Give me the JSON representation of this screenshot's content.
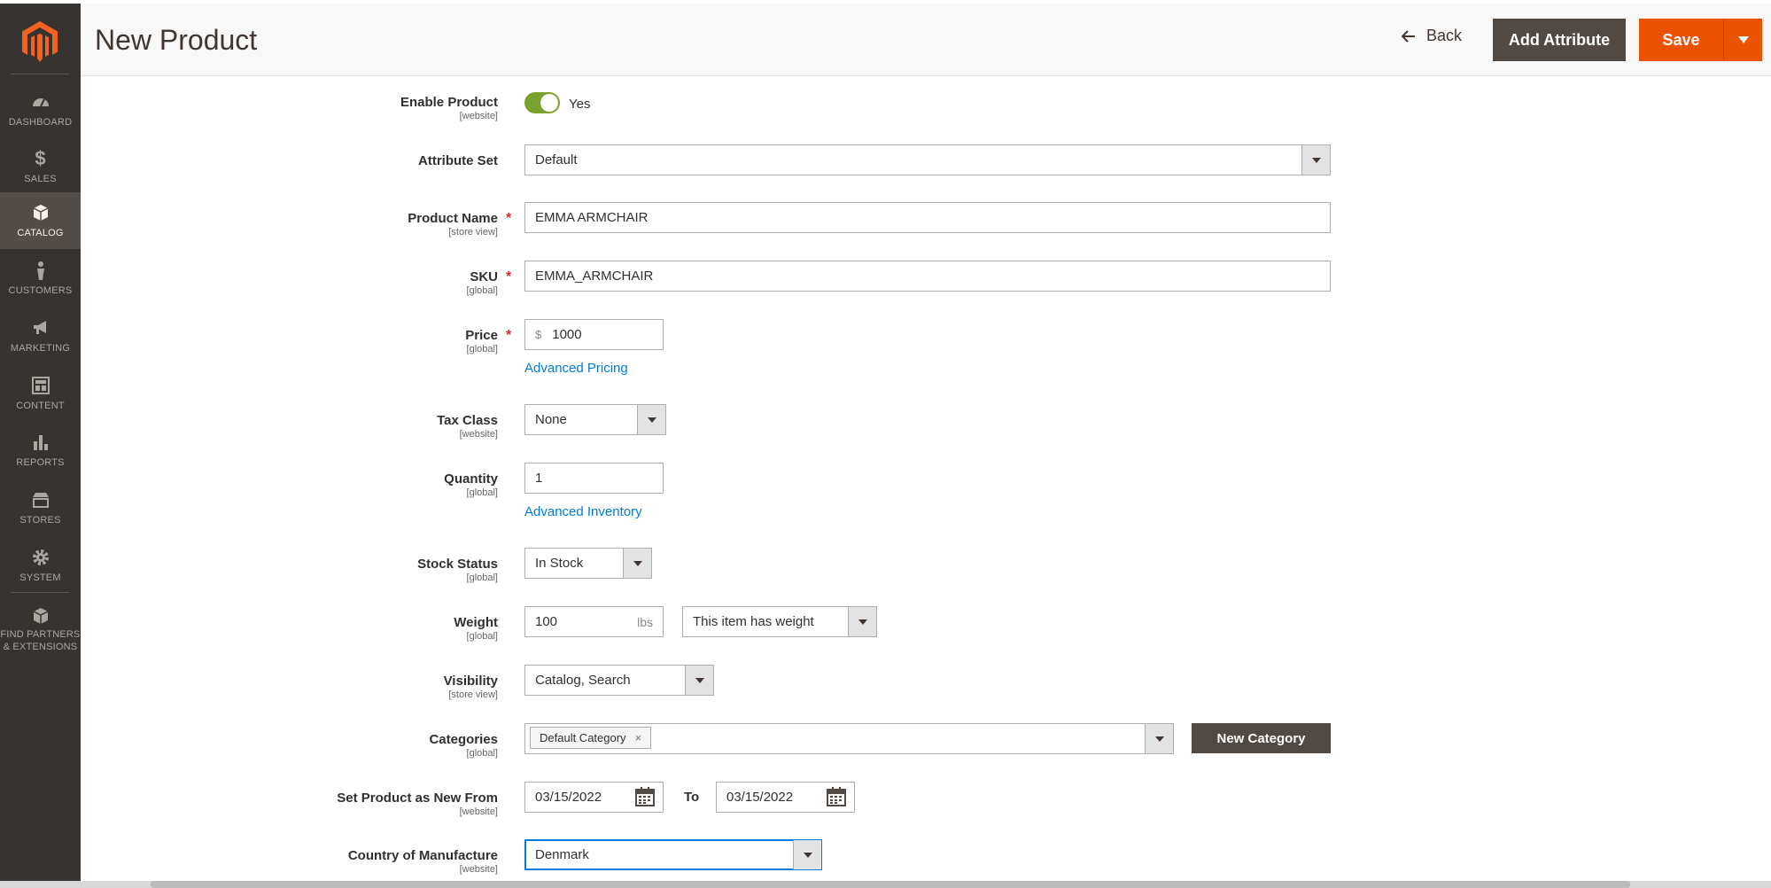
{
  "sidebar": {
    "items": [
      {
        "label": "DASHBOARD",
        "icon": "dashboard-icon"
      },
      {
        "label": "SALES",
        "icon": "dollar-icon"
      },
      {
        "label": "CATALOG",
        "icon": "box-icon",
        "active": true
      },
      {
        "label": "CUSTOMERS",
        "icon": "person-icon"
      },
      {
        "label": "MARKETING",
        "icon": "megaphone-icon"
      },
      {
        "label": "CONTENT",
        "icon": "layout-icon"
      },
      {
        "label": "REPORTS",
        "icon": "bar-chart-icon"
      },
      {
        "label": "STORES",
        "icon": "storefront-icon"
      },
      {
        "label": "SYSTEM",
        "icon": "gear-icon"
      }
    ],
    "partners": {
      "line1": "FIND PARTNERS",
      "line2": "& EXTENSIONS",
      "icon": "cubes-icon"
    }
  },
  "header": {
    "title": "New Product",
    "back_label": "Back",
    "add_attribute_label": "Add Attribute",
    "save_label": "Save"
  },
  "form": {
    "enable_product": {
      "label": "Enable Product",
      "scope": "[website]",
      "value": "Yes"
    },
    "attribute_set": {
      "label": "Attribute Set",
      "value": "Default"
    },
    "product_name": {
      "label": "Product Name",
      "scope": "[store view]",
      "value": "EMMA ARMCHAIR"
    },
    "sku": {
      "label": "SKU",
      "scope": "[global]",
      "value": "EMMA_ARMCHAIR"
    },
    "price": {
      "label": "Price",
      "scope": "[global]",
      "currency": "$",
      "value": "1000",
      "link": "Advanced Pricing"
    },
    "tax_class": {
      "label": "Tax Class",
      "scope": "[website]",
      "value": "None"
    },
    "quantity": {
      "label": "Quantity",
      "scope": "[global]",
      "value": "1",
      "link": "Advanced Inventory"
    },
    "stock_status": {
      "label": "Stock Status",
      "scope": "[global]",
      "value": "In Stock"
    },
    "weight": {
      "label": "Weight",
      "scope": "[global]",
      "value": "100",
      "unit": "lbs",
      "type": "This item has weight"
    },
    "visibility": {
      "label": "Visibility",
      "scope": "[store view]",
      "value": "Catalog, Search"
    },
    "categories": {
      "label": "Categories",
      "scope": "[global]",
      "tag": "Default Category",
      "remove": "×",
      "new_button": "New Category"
    },
    "new_from": {
      "label": "Set Product as New From",
      "scope": "[website]",
      "from": "03/15/2022",
      "to_label": "To",
      "to": "03/15/2022"
    },
    "country": {
      "label": "Country of Manufacture",
      "scope": "[website]",
      "value": "Denmark"
    }
  },
  "colors": {
    "accent": "#eb5202",
    "sidebar": "#373330",
    "link": "#007bdb",
    "toggle_on": "#79a22e"
  }
}
